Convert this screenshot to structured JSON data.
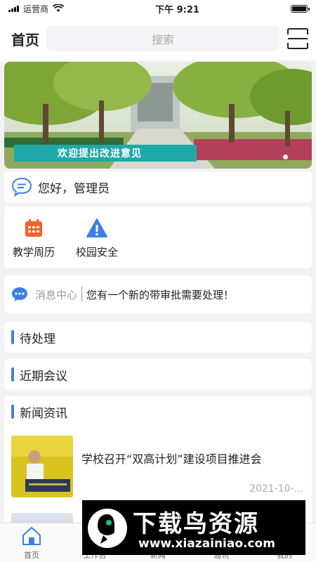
{
  "status_bar": {
    "carrier": "运营商",
    "time": "下午 9:21"
  },
  "header": {
    "title": "首页",
    "search_placeholder": "搜索"
  },
  "banner": {
    "caption": "欢迎提出改进意见",
    "slide_current": 1,
    "slide_count": 2
  },
  "greeting": {
    "text": "您好，管理员"
  },
  "quick_actions": [
    {
      "label": "教学周历",
      "icon": "calendar-icon",
      "color": "#f0642c"
    },
    {
      "label": "校园安全",
      "icon": "warning-icon",
      "color": "#3d7fe9"
    }
  ],
  "message": {
    "label": "消息中心",
    "text": "您有一个新的带审批需要处理！"
  },
  "sections": {
    "pending": "待处理",
    "meetings": "近期会议",
    "news": "新闻资讯"
  },
  "news": [
    {
      "title": "学校召开“双高计划”建设项目推进会",
      "date": "2021-10-..."
    }
  ],
  "tabbar": [
    {
      "label": "首页",
      "icon": "home-icon",
      "active": true
    },
    {
      "label": "工作台",
      "icon": "workbench-icon",
      "active": false
    },
    {
      "label": "新闻",
      "icon": "news-icon",
      "active": false
    },
    {
      "label": "通讯",
      "icon": "contacts-icon",
      "active": false
    },
    {
      "label": "我的",
      "icon": "profile-icon",
      "active": false
    }
  ],
  "watermark": {
    "text": "下载鸟资源",
    "url": "www.xiazainiao.com"
  },
  "colors": {
    "accent": "#3d7fe9",
    "calendar": "#f0642c",
    "caption_bg": "#1fa9a9"
  }
}
